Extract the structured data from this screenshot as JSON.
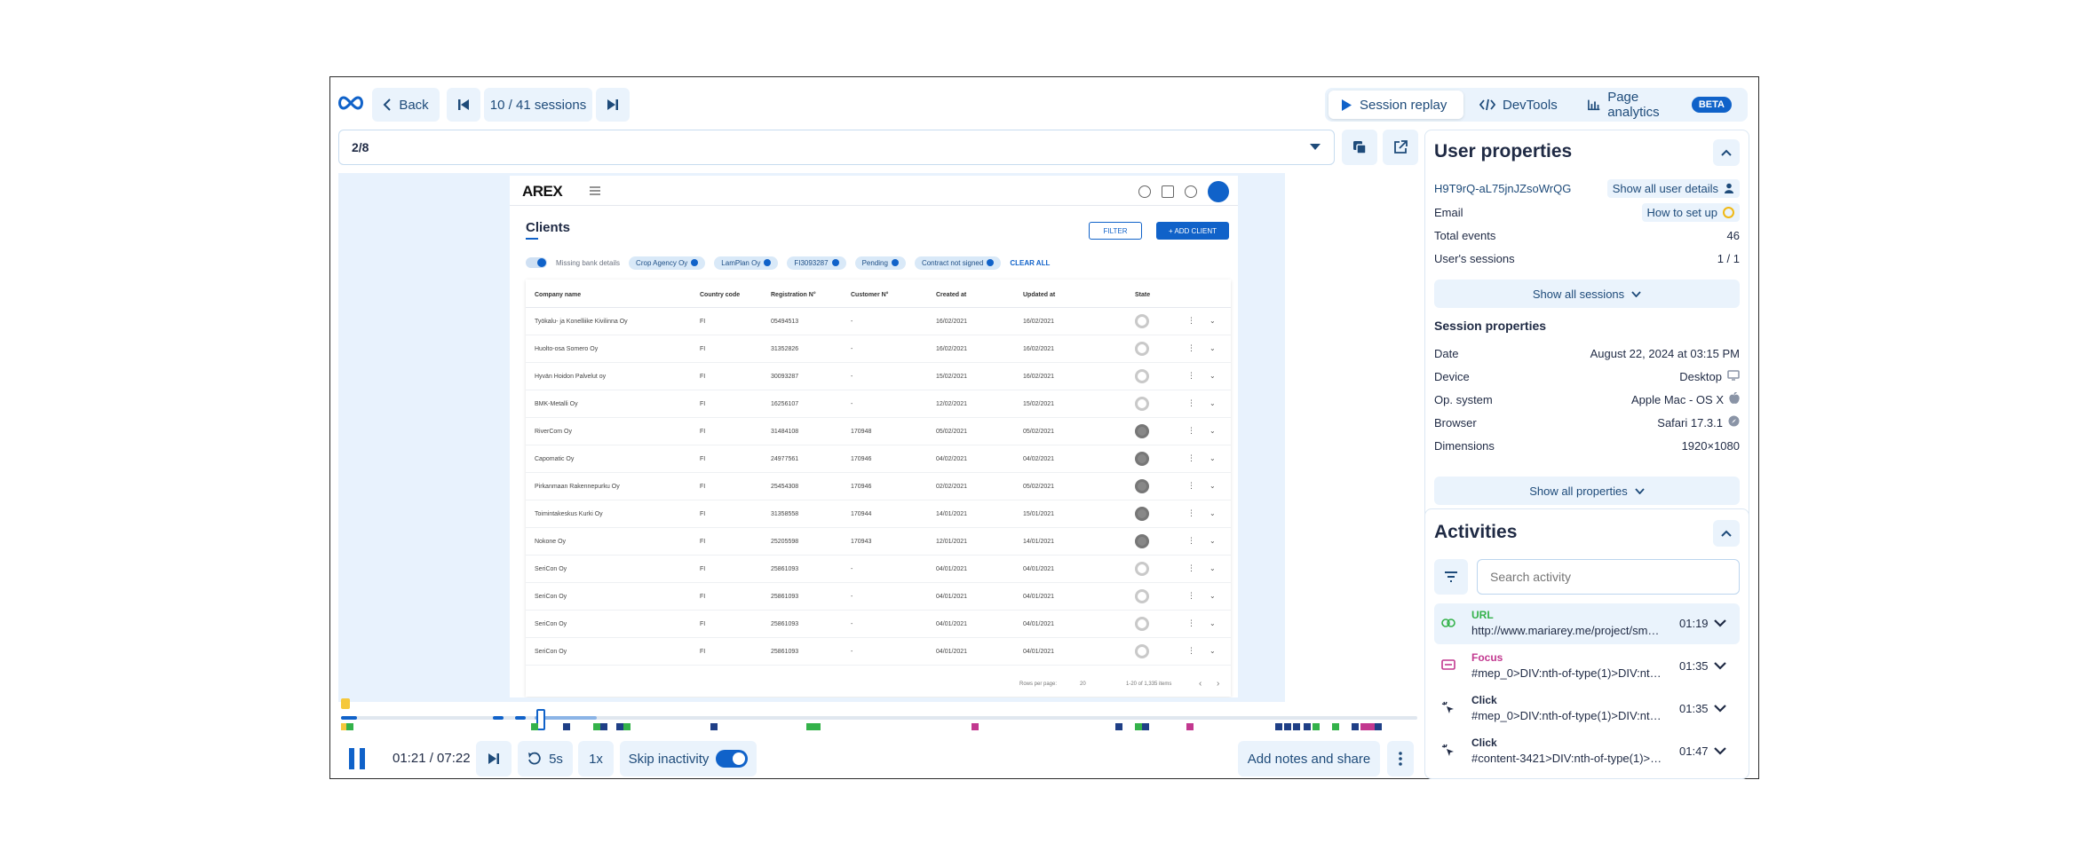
{
  "toolbar": {
    "back_label": "Back",
    "sessions_label": "10 / 41 sessions",
    "tabs": [
      {
        "label": "Session replay",
        "active": true
      },
      {
        "label": "DevTools",
        "active": false
      },
      {
        "label": "Page analytics",
        "active": false,
        "badge": "BETA"
      }
    ]
  },
  "url_bar": {
    "value": "2/8"
  },
  "replay": {
    "app_brand": "AREX",
    "page_title": "Clients",
    "filter_label": "FILTER",
    "add_label": "+ ADD CLIENT",
    "toggle_label": "Missing bank details",
    "chips": [
      "Crop Agency Oy",
      "LamPlan Oy",
      "FI3093287",
      "Pending",
      "Contract not signed"
    ],
    "clear_label": "CLEAR ALL",
    "columns": [
      "Company name",
      "Country code",
      "Registration N°",
      "Customer N°",
      "Created at",
      "Updated at",
      "State"
    ],
    "rows": [
      {
        "name": "Työkalu- ja Konelliike Kivilinna Oy",
        "cc": "FI",
        "reg": "05494513",
        "cust": "-",
        "created": "16/02/2021",
        "updated": "16/02/2021",
        "state": "light"
      },
      {
        "name": "Huolto-osa Somero Oy",
        "cc": "FI",
        "reg": "31352826",
        "cust": "-",
        "created": "16/02/2021",
        "updated": "16/02/2021",
        "state": "light"
      },
      {
        "name": "Hyvän Hoidon Palvelut oy",
        "cc": "FI",
        "reg": "30093287",
        "cust": "-",
        "created": "15/02/2021",
        "updated": "16/02/2021",
        "state": "light"
      },
      {
        "name": "BMK-Metalli Oy",
        "cc": "FI",
        "reg": "16256107",
        "cust": "-",
        "created": "12/02/2021",
        "updated": "15/02/2021",
        "state": "light"
      },
      {
        "name": "RiverCom Oy",
        "cc": "FI",
        "reg": "31484108",
        "cust": "170948",
        "created": "05/02/2021",
        "updated": "05/02/2021",
        "state": "dark"
      },
      {
        "name": "Capomatic Oy",
        "cc": "FI",
        "reg": "24977561",
        "cust": "170946",
        "created": "04/02/2021",
        "updated": "04/02/2021",
        "state": "dark"
      },
      {
        "name": "Pirkanmaan Rakennepurku Oy",
        "cc": "FI",
        "reg": "25454308",
        "cust": "170946",
        "created": "02/02/2021",
        "updated": "05/02/2021",
        "state": "dark"
      },
      {
        "name": "Toimintakeskus Kurki Oy",
        "cc": "FI",
        "reg": "31358558",
        "cust": "170944",
        "created": "14/01/2021",
        "updated": "15/01/2021",
        "state": "dark"
      },
      {
        "name": "Nokone Oy",
        "cc": "FI",
        "reg": "25205598",
        "cust": "170943",
        "created": "12/01/2021",
        "updated": "14/01/2021",
        "state": "dark"
      },
      {
        "name": "SeriCon Oy",
        "cc": "FI",
        "reg": "25861093",
        "cust": "-",
        "created": "04/01/2021",
        "updated": "04/01/2021",
        "state": "light"
      },
      {
        "name": "SeriCon Oy",
        "cc": "FI",
        "reg": "25861093",
        "cust": "-",
        "created": "04/01/2021",
        "updated": "04/01/2021",
        "state": "light"
      },
      {
        "name": "SeriCon Oy",
        "cc": "FI",
        "reg": "25861093",
        "cust": "-",
        "created": "04/01/2021",
        "updated": "04/01/2021",
        "state": "light"
      },
      {
        "name": "SeriCon Oy",
        "cc": "FI",
        "reg": "25861093",
        "cust": "-",
        "created": "04/01/2021",
        "updated": "04/01/2021",
        "state": "light"
      }
    ],
    "pager": {
      "rows_label": "Rows per page:",
      "rows_value": "20",
      "range": "1-20 of 1,335 items"
    }
  },
  "player": {
    "time": "01:21 / 07:22",
    "rewind_label": "5s",
    "speed_label": "1x",
    "skip_label": "Skip inactivity",
    "skip_on": true,
    "notes_label": "Add notes and share"
  },
  "user_props": {
    "title": "User properties",
    "user_id": "H9T9rQ-aL75jnJZsoWrQG",
    "show_user_label": "Show all user details",
    "rows": [
      {
        "label": "Email",
        "value": "How to set up"
      },
      {
        "label": "Total events",
        "value": "46"
      },
      {
        "label": "User's sessions",
        "value": "1 / 1"
      }
    ],
    "show_sessions_label": "Show all sessions",
    "session_title": "Session properties",
    "session_rows": [
      {
        "label": "Date",
        "value": "August 22, 2024 at 03:15 PM",
        "icon": ""
      },
      {
        "label": "Device",
        "value": "Desktop",
        "icon": "monitor-icon"
      },
      {
        "label": "Op. system",
        "value": "Apple Mac - OS X",
        "icon": "apple-icon"
      },
      {
        "label": "Browser",
        "value": "Safari 17.3.1",
        "icon": "compass-icon"
      },
      {
        "label": "Dimensions",
        "value": "1920×1080",
        "icon": ""
      }
    ],
    "show_props_label": "Show all properties"
  },
  "activities": {
    "title": "Activities",
    "search_placeholder": "Search activity",
    "items": [
      {
        "type": "URL",
        "detail": "http://www.mariarey.me/project/small...",
        "time": "01:19",
        "color": "#34b24a",
        "icon": "link-icon"
      },
      {
        "type": "Focus",
        "detail": "#mep_0>DIV:nth-of-type(1)>DIV:nth-...",
        "time": "01:35",
        "color": "#c2388f",
        "icon": "focus-icon"
      },
      {
        "type": "Click",
        "detail": "#mep_0>DIV:nth-of-type(1)>DIV:nth-...",
        "time": "01:35",
        "color": "#1f2a44",
        "icon": "click-icon"
      },
      {
        "type": "Click",
        "detail": "#content-3421>DIV:nth-of-type(1)>D...",
        "time": "01:47",
        "color": "#1f2a44",
        "icon": "click-icon"
      }
    ]
  },
  "colors": {
    "accent": "#1062c9",
    "soft": "#eaf3fc",
    "url": "#34b24a",
    "focus": "#c2388f"
  }
}
